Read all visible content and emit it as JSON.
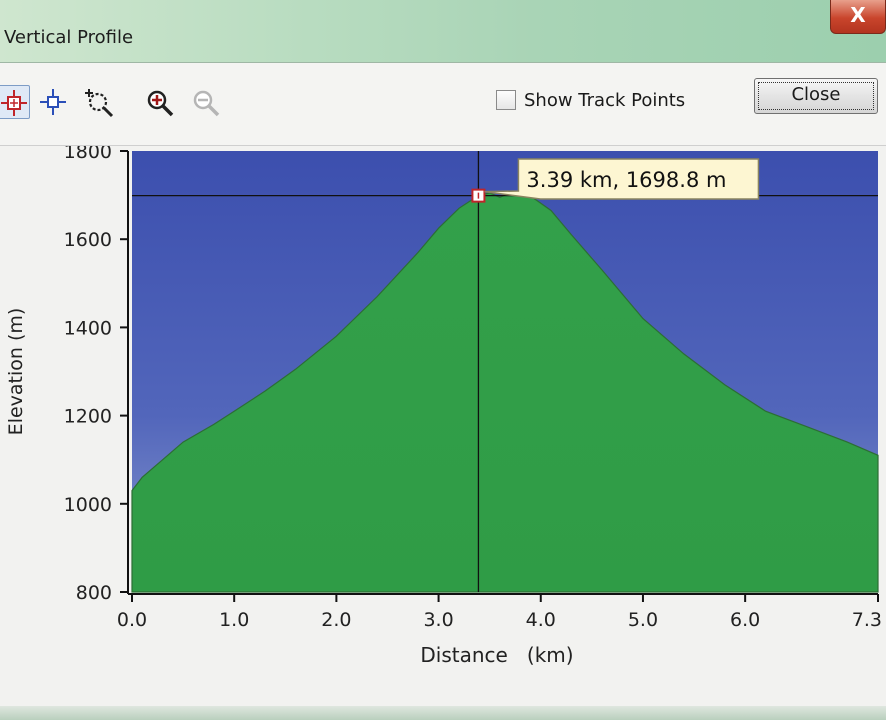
{
  "window": {
    "title": "Vertical Profile",
    "close_glyph": "X"
  },
  "toolbar": {
    "tools": [
      {
        "name": "track-cursor-tool",
        "icon": "crosshair-red-icon",
        "active": true
      },
      {
        "name": "point-cursor-tool",
        "icon": "crosshair-blue-icon",
        "active": false
      },
      {
        "name": "zoom-box-tool",
        "icon": "zoom-region-icon",
        "active": false
      },
      {
        "name": "zoom-in-tool",
        "icon": "zoom-in-icon",
        "active": false
      },
      {
        "name": "zoom-out-tool",
        "icon": "zoom-out-icon",
        "active": false,
        "disabled": true
      }
    ],
    "show_track_points": {
      "label": "Show Track Points",
      "checked": false
    },
    "close_label": "Close"
  },
  "chart_data": {
    "type": "area",
    "title": "",
    "xlabel": "Distance   (km)",
    "ylabel": "Elevation (m)",
    "xlim": [
      0,
      7.3
    ],
    "ylim": [
      800,
      1800
    ],
    "x_ticks": [
      "0.0",
      "1.0",
      "2.0",
      "3.0",
      "4.0",
      "5.0",
      "6.0",
      "7.3"
    ],
    "y_ticks": [
      "800",
      "1000",
      "1200",
      "1400",
      "1600",
      "1800"
    ],
    "grid": false,
    "colors": {
      "fill": "#35a24b",
      "background": "#3b4fb0",
      "outline": "#2c6e34"
    },
    "series": [
      {
        "x": [
          0.0,
          0.1,
          0.3,
          0.5,
          0.8,
          1.0,
          1.3,
          1.6,
          2.0,
          2.4,
          2.8,
          3.0,
          3.2,
          3.39,
          3.5,
          3.6,
          3.7,
          3.8,
          3.9,
          4.1,
          4.3,
          4.6,
          5.0,
          5.4,
          5.8,
          6.2,
          6.6,
          7.0,
          7.3
        ],
        "y": [
          1030,
          1060,
          1100,
          1140,
          1180,
          1210,
          1255,
          1305,
          1380,
          1470,
          1570,
          1625,
          1670,
          1698.8,
          1705,
          1695,
          1705,
          1700,
          1698,
          1665,
          1610,
          1530,
          1420,
          1340,
          1270,
          1210,
          1175,
          1140,
          1110
        ]
      }
    ],
    "cursor": {
      "x": 3.39,
      "y": 1698.8,
      "label": "3.39 km, 1698.8 m"
    }
  }
}
